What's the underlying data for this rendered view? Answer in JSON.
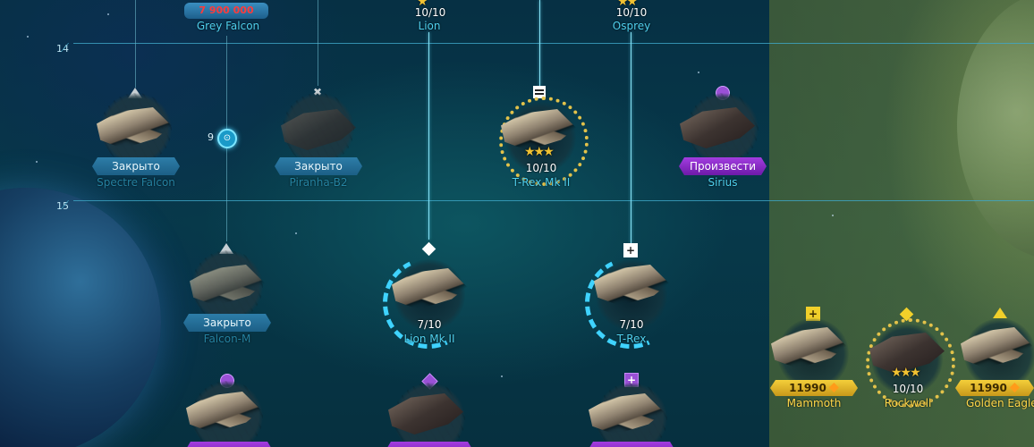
{
  "tiers": [
    {
      "label": "14"
    },
    {
      "label": "15"
    }
  ],
  "top_row": {
    "grey_falcon": {
      "name": "Grey Falcon",
      "cost": "7 900 000"
    },
    "lion": {
      "name": "Lion",
      "progress": "10/10"
    },
    "osprey": {
      "name": "Osprey",
      "progress": "10/10"
    }
  },
  "tier14": {
    "spectre_falcon": {
      "name": "Spectre Falcon",
      "status": "Закрыто"
    },
    "lock_node": {
      "count": "9"
    },
    "piranha_b2": {
      "name": "Piranha-B2",
      "status": "Закрыто"
    },
    "t_rex_mk2": {
      "name": "T-Rex Mk II",
      "progress": "10/10"
    },
    "sirius": {
      "name": "Sirius",
      "action": "Произвести"
    }
  },
  "tier15": {
    "falcon_m": {
      "name": "Falcon-M",
      "status": "Закрыто"
    },
    "lion_mk2": {
      "name": "Lion Mk II",
      "progress": "7/10"
    },
    "t_rex": {
      "name": "T-Rex",
      "progress": "7/10"
    },
    "mammoth": {
      "name": "Mammoth",
      "price": "11990"
    },
    "rockwell": {
      "name": "Rockwell",
      "progress": "10/10"
    },
    "golden_eagle": {
      "name": "Golden Eagle",
      "price": "11990"
    }
  },
  "colors": {
    "locked_badge": "#1c5f86",
    "produce_badge": "#6d1aa8",
    "price_badge": "#c8981a",
    "name_cyan": "#4fd0ee",
    "name_gold": "#ffd74a",
    "progress_arc": "#3fd3ff"
  },
  "icons": {
    "spectre_falcon": "triangle-icon",
    "piranha_b2": "x-cross-icon",
    "t_rex_mk2": "rank-bars-icon",
    "sirius": "purple-triangle-icon",
    "falcon_m": "triangle-icon",
    "lion_mk2": "diamond-icon",
    "t_rex": "plus-icon",
    "mammoth": "yellow-plus-icon",
    "rockwell": "yellow-diamond-icon",
    "golden_eagle": "yellow-triangle-icon",
    "lock_node": "lock-icon",
    "currency": "crystal-icon"
  }
}
